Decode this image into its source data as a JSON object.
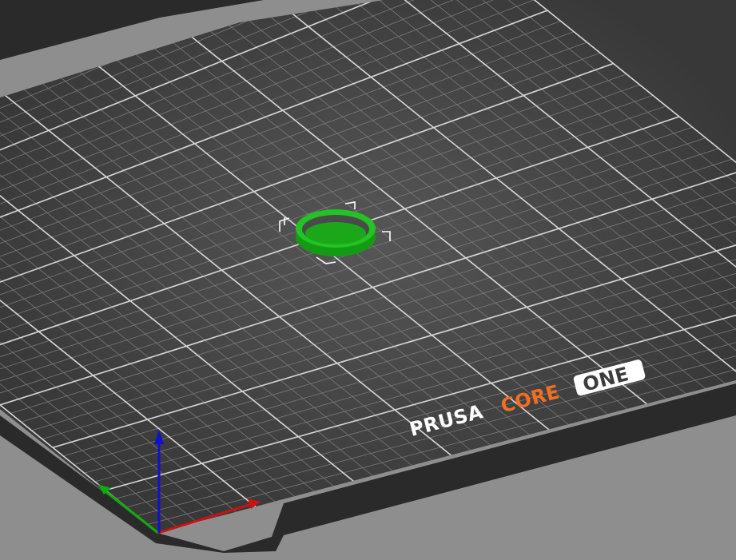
{
  "viewport": {
    "background_color": "#8e8e8e",
    "bed_color": "#3c3c3c",
    "bed_edge_color": "#2a2a2a",
    "grid_minor_color": "#7a7a7a",
    "grid_major_color": "#d8d8d8"
  },
  "bed_logo": {
    "word_prusa": "PRUSA",
    "word_core": "CORE",
    "word_one": "ONE",
    "prusa_color": "#ffffff",
    "core_color": "#f26f21",
    "one_badge_color": "#ffffff",
    "one_text_color": "#3c3c3c"
  },
  "model": {
    "shape": "ring",
    "color": "#22c322",
    "selected": true
  },
  "axes": {
    "x_color": "#cc1111",
    "y_color": "#11aa11",
    "z_color": "#1111cc"
  }
}
